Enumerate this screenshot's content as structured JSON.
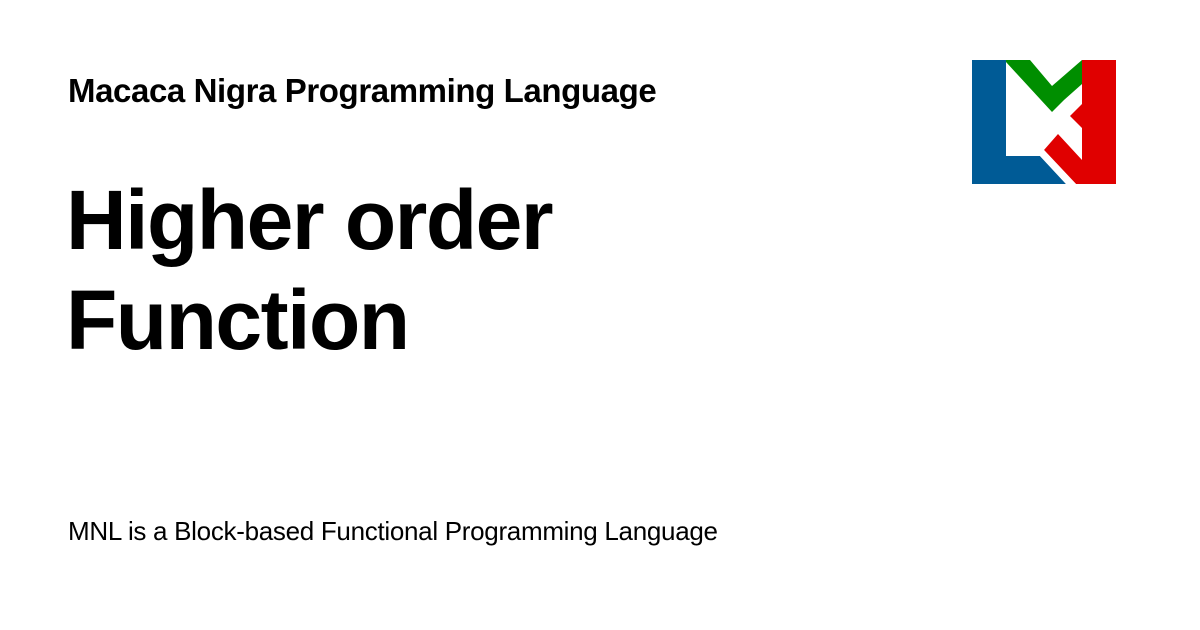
{
  "header": {
    "site_name": "Macaca Nigra Programming Language"
  },
  "title": {
    "line1": "Higher order",
    "line2": "Function"
  },
  "footer": {
    "tagline": "MNL is a Block-based Functional Programming Language"
  },
  "logo": {
    "icon": "mnl-logo-icon",
    "colors": {
      "blue": "#005b96",
      "green": "#008e00",
      "red": "#e00000",
      "white": "#ffffff"
    }
  }
}
